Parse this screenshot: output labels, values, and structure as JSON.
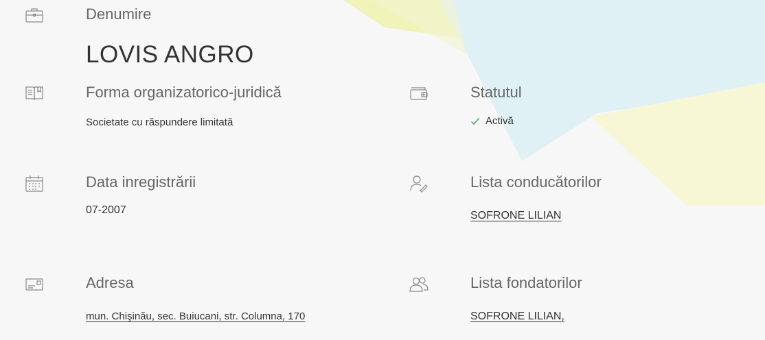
{
  "denumire": {
    "label": "Denumire",
    "value": "LOVIS ANGRO"
  },
  "forma": {
    "label": "Forma organizatorico-juridică",
    "value": "Societate cu răspundere limitată"
  },
  "statut": {
    "label": "Statutul",
    "value": "Activă",
    "color": "#3aa55a"
  },
  "data_inregistrarii": {
    "label": "Data inregistrării",
    "value": "07-2007"
  },
  "conducatori": {
    "label": "Lista conducătorilor",
    "items": [
      "SOFRONE LILIAN"
    ]
  },
  "adresa": {
    "label": "Adresa",
    "value": "mun. Chişinău, sec. Buiucani, str. Columna, 170"
  },
  "fondatori": {
    "label": "Lista fondatorilor",
    "items": [
      "SOFRONE LILIAN,"
    ]
  },
  "icons": {
    "denumire": "briefcase-icon",
    "forma": "book-icon",
    "statut": "wallet-icon",
    "data": "calendar-icon",
    "conducatori": "person-icon",
    "adresa": "address-card-icon",
    "fondatori": "people-icon"
  }
}
